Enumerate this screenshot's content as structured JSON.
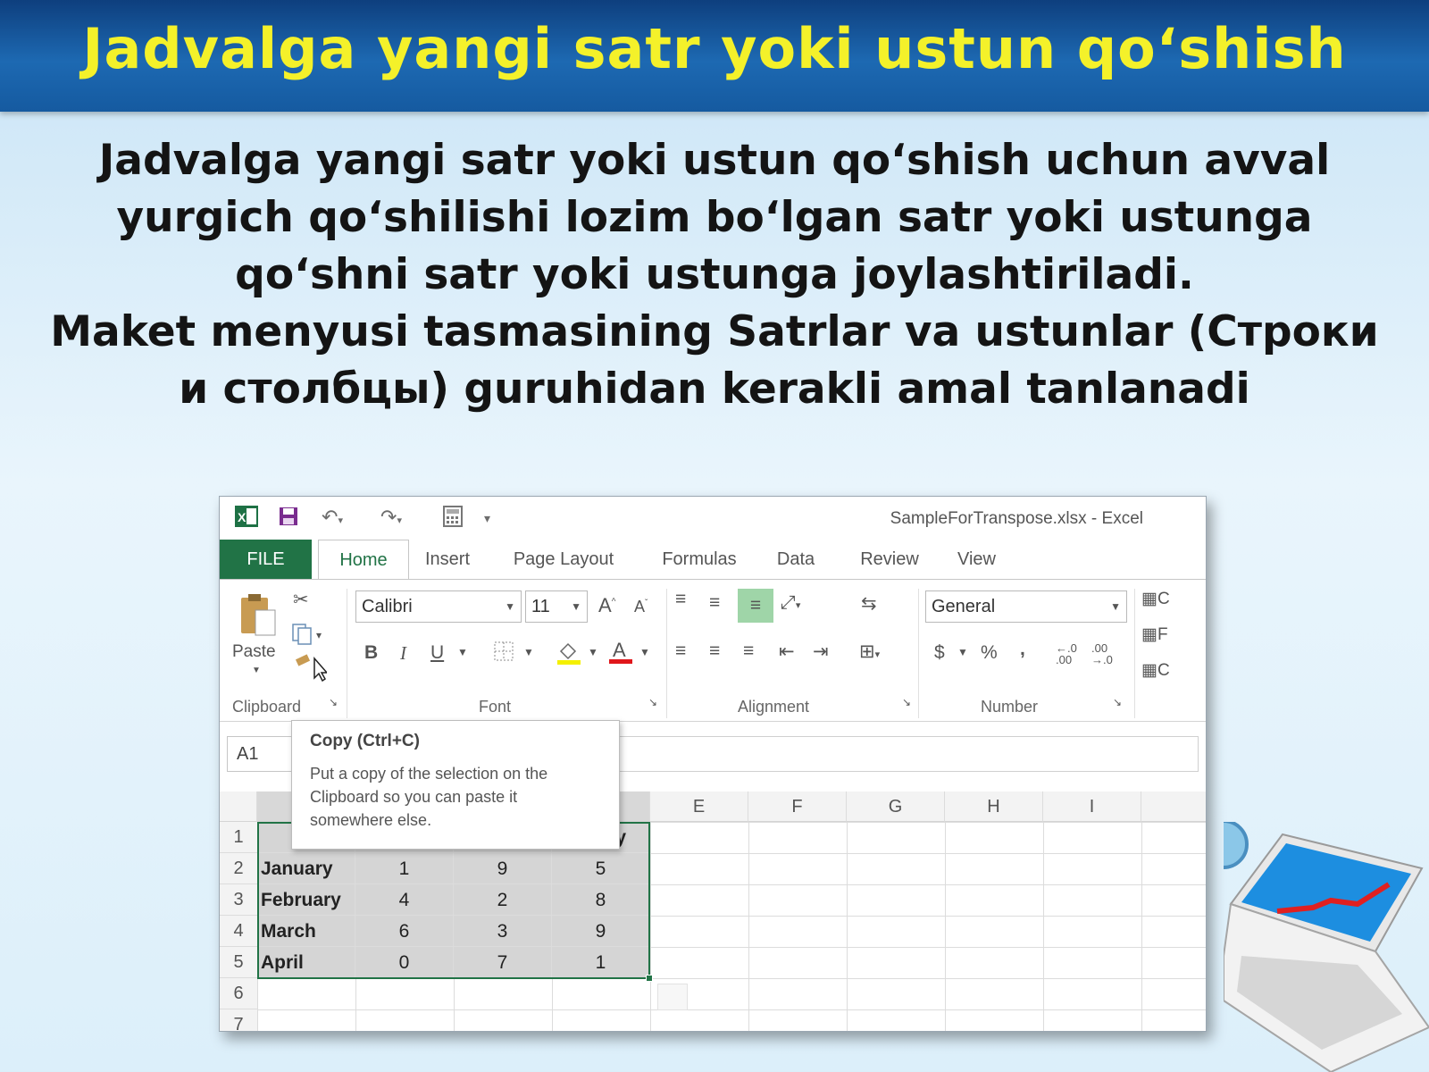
{
  "slide": {
    "title": "Jadvalga yangi satr yoki ustun qo‘shish",
    "line1": "Jadvalga yangi satr yoki ustun qo‘shish uchun avval",
    "line2": "yurgich qo‘shilishi lozim bo‘lgan satr yoki ustunga",
    "line3": "qo‘shni satr yoki ustunga joylashtiriladi.",
    "line4": "Maket menyusi tasmasining Satrlar va ustunlar (Строки",
    "line5": "и столбцы) guruhidan kerakli amal tanlanadi"
  },
  "excel": {
    "window_title": "SampleForTranspose.xlsx - Excel",
    "tabs": [
      "FILE",
      "Home",
      "Insert",
      "Page Layout",
      "Formulas",
      "Data",
      "Review",
      "View"
    ],
    "ribbon": {
      "paste_label": "Paste",
      "font_name": "Calibri",
      "font_size": "11",
      "number_format": "General",
      "bold": "B",
      "italic": "I",
      "underline": "U",
      "currency": "$",
      "percent": "%",
      "comma": ",",
      "groups": [
        "Clipboard",
        "Font",
        "Alignment",
        "Number"
      ],
      "styles_letters": [
        "C",
        "F",
        "C"
      ]
    },
    "name_box": "A1",
    "tooltip": {
      "title": "Copy (Ctrl+C)",
      "description": "Put a copy of the selection on the Clipboard so you can paste it somewhere else."
    },
    "column_headers": [
      "E",
      "F",
      "G",
      "H",
      "I"
    ],
    "row_headers": [
      "1",
      "2",
      "3",
      "4",
      "5",
      "6",
      "7"
    ],
    "row1_visible_fragment": "y",
    "rows": [
      {
        "label": "January",
        "values": [
          "1",
          "9",
          "5"
        ]
      },
      {
        "label": "February",
        "values": [
          "4",
          "2",
          "8"
        ]
      },
      {
        "label": "March",
        "values": [
          "6",
          "3",
          "9"
        ]
      },
      {
        "label": "April",
        "values": [
          "0",
          "7",
          "1"
        ]
      }
    ]
  },
  "colors": {
    "banner": "#1d69b2",
    "title_text": "#f4f12a",
    "excel_green": "#217346",
    "selection": "#d5d5d5"
  }
}
